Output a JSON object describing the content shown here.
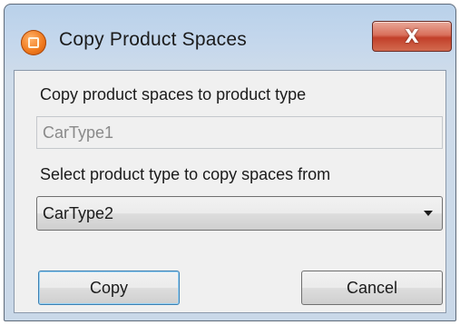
{
  "window": {
    "title": "Copy Product Spaces",
    "close_icon": "close-icon",
    "close_glyph": "X"
  },
  "form": {
    "target_label": "Copy product spaces to product type",
    "target_value": "CarType1",
    "source_label": "Select product type to copy spaces from",
    "source_selected": "CarType2"
  },
  "buttons": {
    "copy_label": "Copy",
    "cancel_label": "Cancel"
  },
  "colors": {
    "title_accent": "#b9d1ea",
    "close_button": "#c2402a",
    "default_button_border": "#3c7fb1"
  }
}
